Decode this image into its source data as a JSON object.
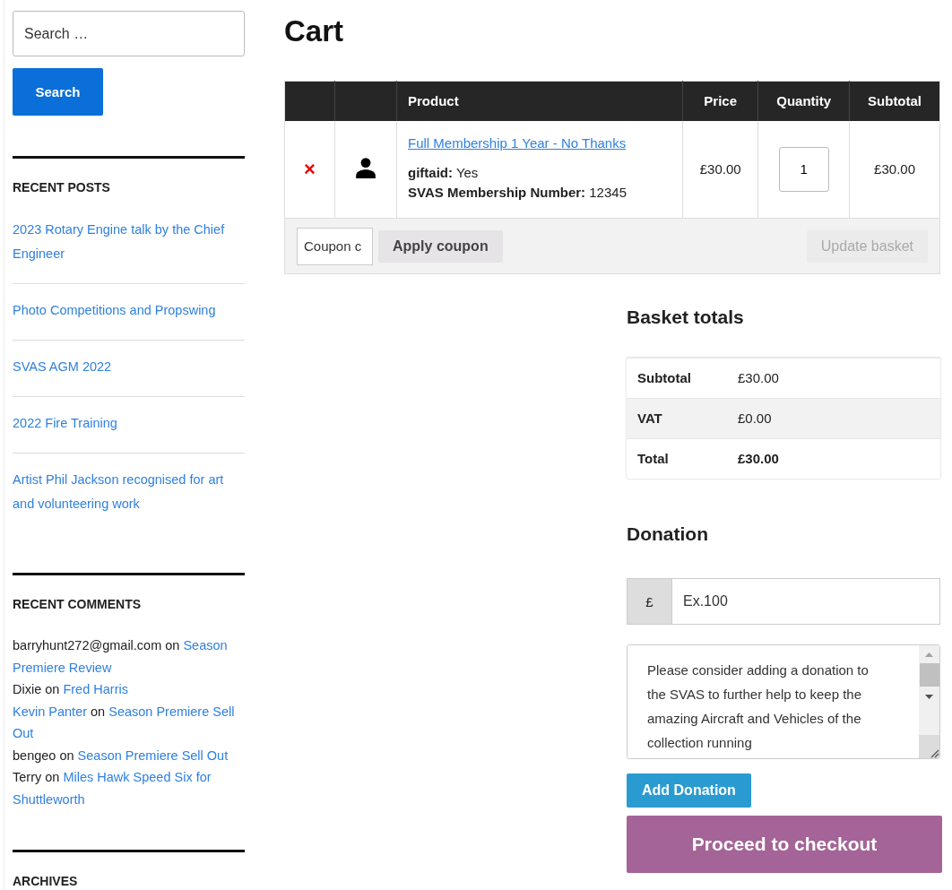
{
  "sidebar": {
    "search": {
      "placeholder": "Search …",
      "button": "Search"
    },
    "recent_posts": {
      "title": "RECENT POSTS",
      "items": [
        "2023 Rotary Engine talk by the Chief Engineer",
        "Photo Competitions and Propswing",
        "SVAS AGM 2022",
        "2022 Fire Training",
        "Artist Phil Jackson recognised for art and volunteering work"
      ]
    },
    "recent_comments": {
      "title": "RECENT COMMENTS",
      "items": [
        {
          "author": "barryhunt272@gmail.com",
          "author_is_link": false,
          "on": "on",
          "post": "Season Premiere Review"
        },
        {
          "author": "Dixie",
          "author_is_link": false,
          "on": "on",
          "post": "Fred Harris"
        },
        {
          "author": "Kevin Panter",
          "author_is_link": true,
          "on": "on",
          "post": "Season Premiere Sell Out"
        },
        {
          "author": "bengeo",
          "author_is_link": false,
          "on": "on",
          "post": "Season Premiere Sell Out"
        },
        {
          "author": "Terry",
          "author_is_link": false,
          "on": "on",
          "post": "Miles Hawk Speed Six for Shuttleworth"
        }
      ]
    },
    "archives": {
      "title": "ARCHIVES"
    }
  },
  "cart": {
    "title": "Cart",
    "columns": [
      "Product",
      "Price",
      "Quantity",
      "Subtotal"
    ],
    "rows": [
      {
        "remove": "×",
        "product": "Full Membership 1 Year - No Thanks",
        "meta": [
          {
            "key": "giftaid:",
            "value": "Yes"
          },
          {
            "key": "SVAS Membership Number:",
            "value": "12345"
          }
        ],
        "price": "£30.00",
        "quantity": "1",
        "subtotal": "£30.00"
      }
    ],
    "coupon": {
      "placeholder": "Coupon c",
      "button": "Apply coupon"
    },
    "update_button": {
      "label": "Update basket",
      "disabled": true
    }
  },
  "totals": {
    "title": "Basket totals",
    "rows": [
      {
        "label": "Subtotal",
        "value": "£30.00",
        "strong": false
      },
      {
        "label": "VAT",
        "value": "£0.00",
        "strong": false
      },
      {
        "label": "Total",
        "value": "£30.00",
        "strong": true
      }
    ]
  },
  "donation": {
    "title": "Donation",
    "currency": "£",
    "placeholder": "Ex.100",
    "message": "Please consider adding a donation to the SVAS to further help to keep the amazing Aircraft and Vehicles of the collection running",
    "button": "Add Donation"
  },
  "checkout_button": "Proceed to checkout"
}
